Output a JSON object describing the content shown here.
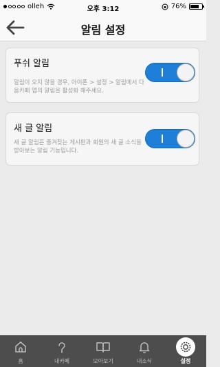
{
  "status": {
    "carrier": "olleh",
    "time": "오후 3:12",
    "battery": "76%",
    "battery_level": 0.76
  },
  "nav": {
    "title": "알림 설정"
  },
  "settings": [
    {
      "title": "푸쉬 알림",
      "desc": "알림이 오지 않을 경우, 아이폰 > 설정 > 알림에서 다음카페 앱의 알림을 활성화 해주세요.",
      "enabled": true
    },
    {
      "title": "새 글 알림",
      "desc": "새 글 알림은 즐겨찾는 게시판과 회원의 새 글 소식을 받아보는 알림 기능입니다.",
      "enabled": true
    }
  ],
  "tabs": [
    {
      "label": "홈",
      "icon": "home-icon"
    },
    {
      "label": "내카페",
      "icon": "my-cafe-icon"
    },
    {
      "label": "모아보기",
      "icon": "book-icon"
    },
    {
      "label": "내소식",
      "icon": "bell-icon"
    },
    {
      "label": "설정",
      "icon": "settings-icon",
      "active": true
    }
  ],
  "colors": {
    "toggle_on": "#1e7ed8",
    "tabbar": "#4d4d4d",
    "background": "#ebebeb"
  }
}
